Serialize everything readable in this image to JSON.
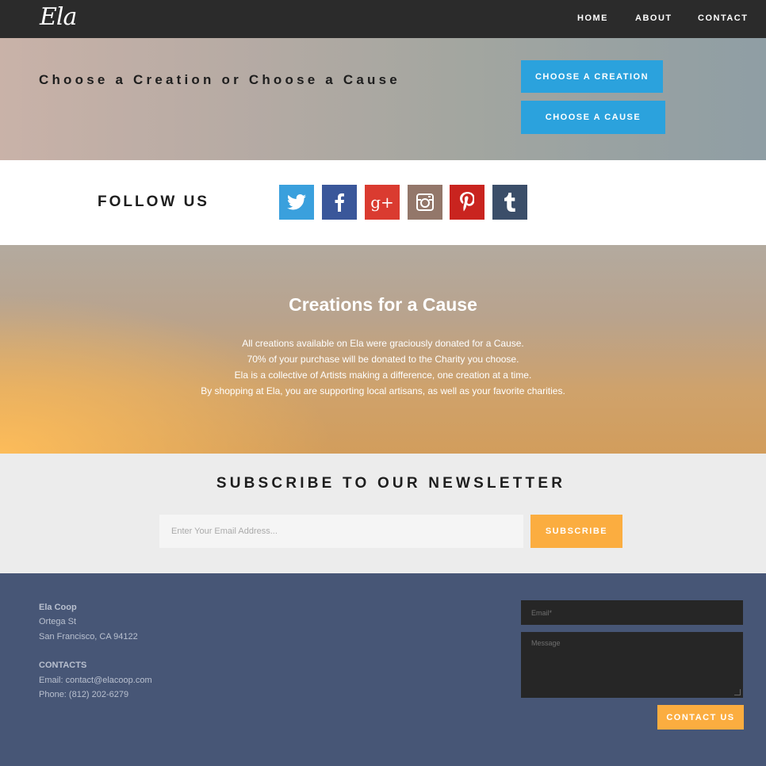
{
  "nav": {
    "logo": "Ela",
    "links": [
      "HOME",
      "ABOUT",
      "CONTACT"
    ]
  },
  "hero": {
    "title": "Choose a Creation or Choose a Cause",
    "btn_creation": "CHOOSE A CREATION",
    "btn_cause": "CHOOSE A CAUSE"
  },
  "follow": {
    "title": "FOLLOW US",
    "icons": [
      {
        "name": "twitter-icon",
        "color": "#3aa0dd"
      },
      {
        "name": "facebook-icon",
        "color": "#3a579a"
      },
      {
        "name": "google-plus-icon",
        "color": "#da3b30"
      },
      {
        "name": "instagram-icon",
        "color": "#93776a"
      },
      {
        "name": "pinterest-icon",
        "color": "#c9241f"
      },
      {
        "name": "tumblr-icon",
        "color": "#3b4e69"
      }
    ]
  },
  "cause": {
    "title": "Creations for a Cause",
    "lines": [
      "All creations available on Ela were graciously donated for a Cause.",
      "70% of your purchase will be donated to the Charity you choose.",
      "Ela is a collective of Artists making a difference, one creation at a time.",
      "By shopping at Ela, you are supporting local artisans, as well as your favorite charities."
    ]
  },
  "newsletter": {
    "title": "SUBSCRIBE TO OUR NEWSLETTER",
    "placeholder": "Enter Your Email Address...",
    "button": "SUBSCRIBE"
  },
  "footer": {
    "company": "Ela Coop",
    "street": "Ortega St",
    "city": "San Francisco, CA 94122",
    "contacts_heading": "CONTACTS",
    "email": "Email: contact@elacoop.com",
    "phone": "Phone: (812) 202-6279",
    "email_placeholder": "Email*",
    "message_placeholder": "Message",
    "contact_button": "CONTACT US"
  },
  "colors": {
    "nav_bg": "#2b2b2b",
    "accent_blue": "#2ba2dd",
    "accent_orange": "#fbad40",
    "footer_bg": "#475676"
  }
}
